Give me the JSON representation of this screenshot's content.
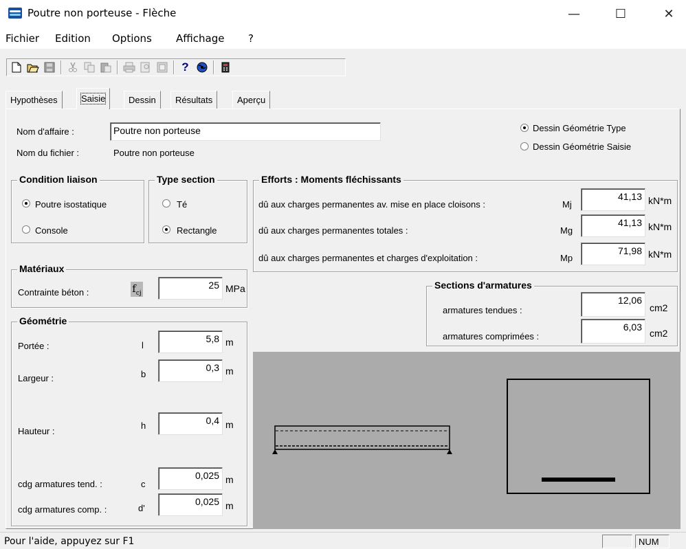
{
  "window": {
    "title": "Poutre non porteuse - Flèche",
    "minimize": "—",
    "maximize": "☐",
    "close": "✕"
  },
  "menu": [
    "Fichier",
    "Edition",
    "Options",
    "Affichage",
    "?"
  ],
  "tabs": [
    "Hypothèses",
    "Saisie",
    "Dessin",
    "Résultats",
    "Aperçu"
  ],
  "info": {
    "nom_affaire_label": "Nom d'affaire :",
    "nom_affaire_value": "Poutre non porteuse",
    "nom_fichier_label": "Nom du fichier :",
    "nom_fichier_value": "Poutre non porteuse"
  },
  "dessin_options": {
    "type_label": "Dessin Géométrie Type",
    "saisie_label": "Dessin Géométrie Saisie",
    "selected": "type"
  },
  "condition_liaison": {
    "title": "Condition liaison",
    "options": [
      "Poutre isostatique",
      "Console"
    ],
    "selected": 0
  },
  "type_section": {
    "title": "Type section",
    "options": [
      "Té",
      "Rectangle"
    ],
    "selected": 1
  },
  "efforts": {
    "title": "Efforts : Moments fléchissants",
    "rows": [
      {
        "label": "dû aux charges permanentes av. mise en place cloisons :",
        "symbol": "Mj",
        "value": "41,13",
        "unit": "kN*m"
      },
      {
        "label": "dû aux charges permanentes totales :",
        "symbol": "Mg",
        "value": "41,13",
        "unit": "kN*m"
      },
      {
        "label": "dû aux charges permanentes et charges d'exploitation :",
        "symbol": "Mp",
        "value": "71,98",
        "unit": "kN*m"
      }
    ]
  },
  "materiaux": {
    "title": "Matériaux",
    "contrainte_label": "Contrainte béton :",
    "symbol": "fcj",
    "value": "25",
    "unit": "MPa"
  },
  "sections": {
    "title": "Sections d'armatures",
    "rows": [
      {
        "label": "armatures tendues :",
        "value": "12,06",
        "unit": "cm2"
      },
      {
        "label": "armatures comprimées :",
        "value": "6,03",
        "unit": "cm2"
      }
    ]
  },
  "geometrie": {
    "title": "Géométrie",
    "rows": [
      {
        "label": "Portée :",
        "symbol": "l",
        "value": "5,8",
        "unit": "m"
      },
      {
        "label": "Largeur :",
        "symbol": "b",
        "value": "0,3",
        "unit": "m"
      },
      {
        "label": "Hauteur :",
        "symbol": "h",
        "value": "0,4",
        "unit": "m"
      },
      {
        "label": "cdg armatures tend. :",
        "symbol": "c",
        "value": "0,025",
        "unit": "m"
      },
      {
        "label": "cdg armatures comp. :",
        "symbol": "d'",
        "value": "0,025",
        "unit": "m"
      }
    ]
  },
  "status": {
    "text": "Pour l'aide, appuyez sur F1",
    "num": "NUM"
  }
}
